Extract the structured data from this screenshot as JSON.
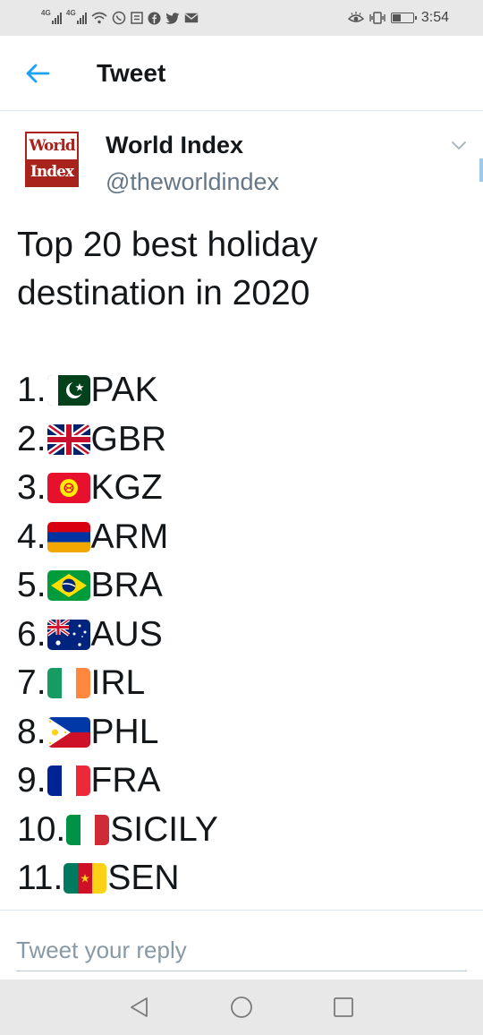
{
  "status_bar": {
    "network_1": "4G",
    "network_2": "4G",
    "time": "3:54"
  },
  "header": {
    "title": "Tweet"
  },
  "tweet": {
    "logo_line1": "World",
    "logo_line2": "Index",
    "author_name": "World Index",
    "author_handle": "@theworldindex",
    "headline": "Top 20 best holiday destination in 2020",
    "ranking": [
      {
        "rank": "1.",
        "flag": "pakistan-flag-icon",
        "code": "PAK"
      },
      {
        "rank": "2.",
        "flag": "united-kingdom-flag-icon",
        "code": "GBR"
      },
      {
        "rank": "3.",
        "flag": "kyrgyzstan-flag-icon",
        "code": "KGZ"
      },
      {
        "rank": "4.",
        "flag": "armenia-flag-icon",
        "code": "ARM"
      },
      {
        "rank": "5.",
        "flag": "brazil-flag-icon",
        "code": "BRA"
      },
      {
        "rank": "6.",
        "flag": "australia-flag-icon",
        "code": "AUS"
      },
      {
        "rank": "7.",
        "flag": "ireland-flag-icon",
        "code": "IRL"
      },
      {
        "rank": "8.",
        "flag": "philippines-flag-icon",
        "code": "PHL"
      },
      {
        "rank": "9.",
        "flag": "france-flag-icon",
        "code": "FRA"
      },
      {
        "rank": "10.",
        "flag": "italy-flag-icon",
        "code": "SICILY"
      },
      {
        "rank": "11.",
        "flag": "cameroon-flag-icon",
        "code": "SEN"
      }
    ]
  },
  "reply": {
    "placeholder": "Tweet your reply"
  },
  "colors": {
    "accent": "#1da1f2",
    "text": "#14171a",
    "muted": "#657786",
    "logo_red": "#a8231c"
  }
}
